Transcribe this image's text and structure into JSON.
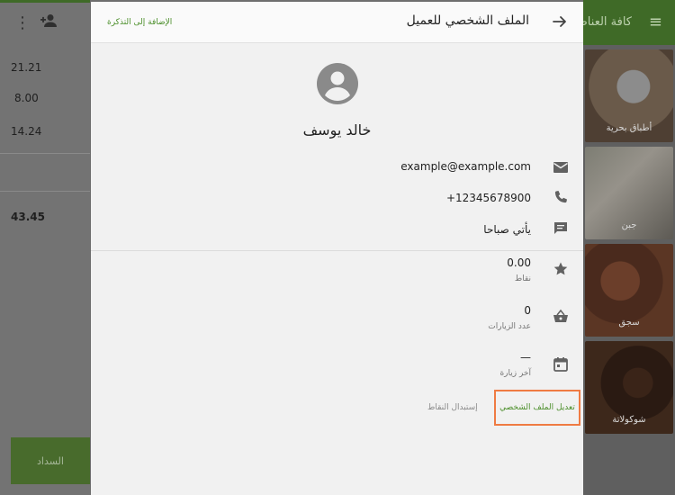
{
  "background": {
    "amounts": [
      "21.21",
      "8.00",
      "14.24",
      "43.45"
    ],
    "pay_label": "السداد",
    "category_header": "كافة العناصر",
    "tiles": [
      {
        "label": "أطباق بحرية"
      },
      {
        "label": "جبن"
      },
      {
        "label": "سجق"
      },
      {
        "label": "شوكولاتة"
      }
    ]
  },
  "dialog": {
    "title": "الملف الشخصي للعميل",
    "add_to_ticket": "الإضافة إلى التذكرة",
    "customer_name": "خالد يوسف",
    "email": "example@example.com",
    "phone": "+12345678900",
    "note": "يأتي صباحا",
    "points_value": "0.00",
    "points_label": "نقاط",
    "visits_value": "0",
    "visits_label": "عدد الزيارات",
    "last_visit_value": "—",
    "last_visit_label": "آخر زيارة",
    "edit_profile": "تعديل الملف الشخصي",
    "redeem_points": "إستبدال النقاط"
  },
  "colors": {
    "accent_green": "#4c8f2b",
    "brand_dark_green": "#3f6a27",
    "highlight_orange": "#ef7b43"
  }
}
